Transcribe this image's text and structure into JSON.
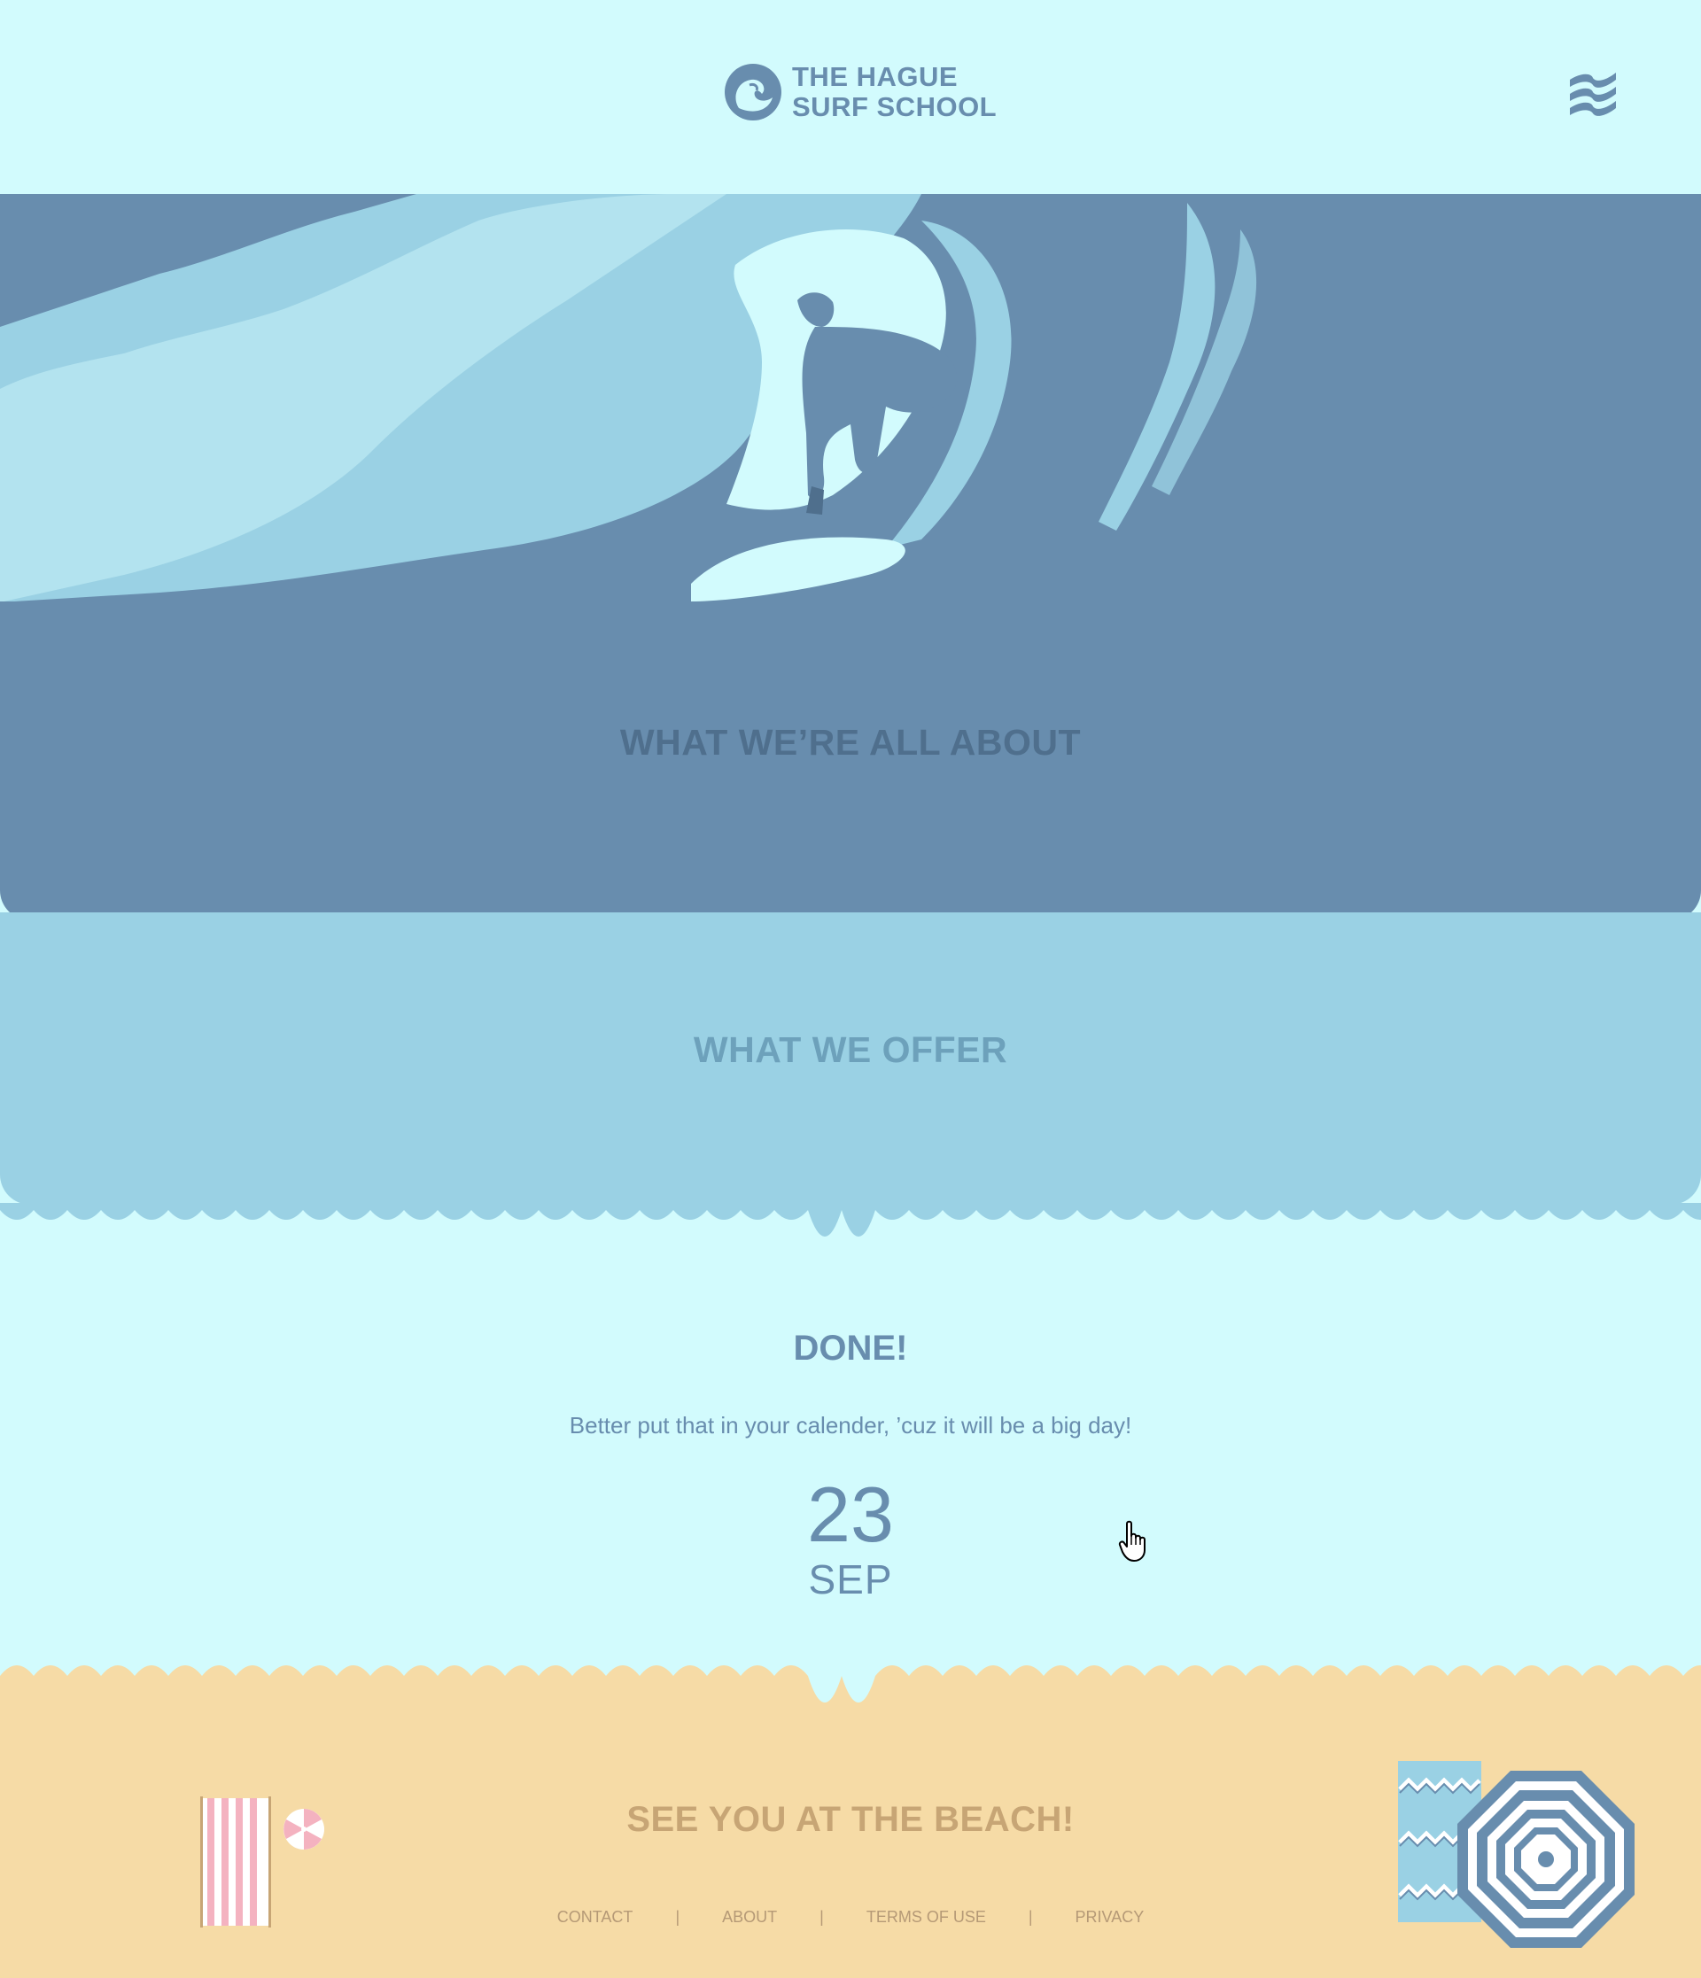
{
  "brand": {
    "line1": "THE HAGUE",
    "line2": "SURF SCHOOL",
    "logo_icon": "wave-circle-icon",
    "menu_icon": "wave-menu-icon"
  },
  "colors": {
    "sky": "#d2fbfd",
    "deep": "#688dae",
    "light": "#9ad1e4",
    "sand": "#f6dba6"
  },
  "sections": {
    "about_title": "WHAT WE’RE ALL ABOUT",
    "offer_title": "WHAT WE OFFER"
  },
  "countdown": {
    "title": "DONE!",
    "subtitle": "Better put that in your calender, ’cuz it will be a big day!",
    "day": "23",
    "month": "SEP"
  },
  "footer": {
    "title": "SEE YOU AT THE BEACH!",
    "links": [
      "CONTACT",
      "ABOUT",
      "TERMS OF USE",
      "PRIVACY"
    ],
    "separator": "|"
  }
}
